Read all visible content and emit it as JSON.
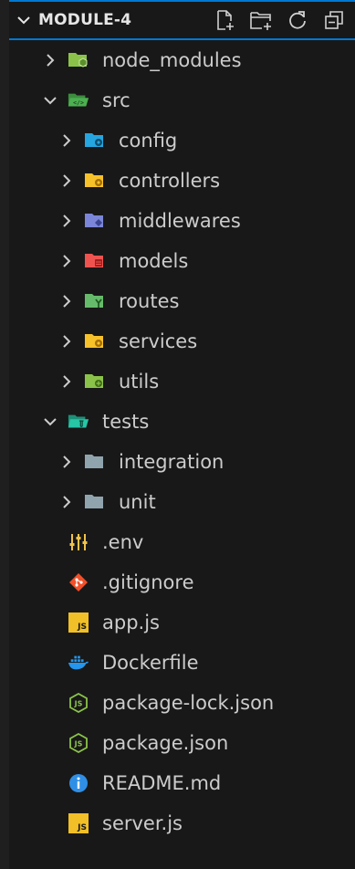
{
  "explorer": {
    "title": "MODULE-4",
    "actions": [
      {
        "name": "new-file-icon"
      },
      {
        "name": "new-folder-icon"
      },
      {
        "name": "refresh-icon"
      },
      {
        "name": "collapse-all-icon"
      }
    ]
  },
  "tree": [
    {
      "label": "node_modules",
      "kind": "folder",
      "expanded": false,
      "depth": 1,
      "icon": "folder-node-icon",
      "color": "#8bc34a"
    },
    {
      "label": "src",
      "kind": "folder",
      "expanded": true,
      "depth": 1,
      "icon": "folder-src-icon",
      "color": "#4caf50"
    },
    {
      "label": "config",
      "kind": "folder",
      "expanded": false,
      "depth": 2,
      "icon": "folder-config-icon",
      "color": "#26a6e0"
    },
    {
      "label": "controllers",
      "kind": "folder",
      "expanded": false,
      "depth": 2,
      "icon": "folder-controllers-icon",
      "color": "#f7c12a"
    },
    {
      "label": "middlewares",
      "kind": "folder",
      "expanded": false,
      "depth": 2,
      "icon": "folder-middlewares-icon",
      "color": "#7b86d8"
    },
    {
      "label": "models",
      "kind": "folder",
      "expanded": false,
      "depth": 2,
      "icon": "folder-models-icon",
      "color": "#ef5350"
    },
    {
      "label": "routes",
      "kind": "folder",
      "expanded": false,
      "depth": 2,
      "icon": "folder-routes-icon",
      "color": "#66bb6a"
    },
    {
      "label": "services",
      "kind": "folder",
      "expanded": false,
      "depth": 2,
      "icon": "folder-services-icon",
      "color": "#f7c12a"
    },
    {
      "label": "utils",
      "kind": "folder",
      "expanded": false,
      "depth": 2,
      "icon": "folder-utils-icon",
      "color": "#8bc34a"
    },
    {
      "label": "tests",
      "kind": "folder",
      "expanded": true,
      "depth": 1,
      "icon": "folder-tests-icon",
      "color": "#26c6a6"
    },
    {
      "label": "integration",
      "kind": "folder",
      "expanded": false,
      "depth": 2,
      "icon": "folder-icon",
      "color": "#90a4ae"
    },
    {
      "label": "unit",
      "kind": "folder",
      "expanded": false,
      "depth": 2,
      "icon": "folder-icon",
      "color": "#90a4ae"
    },
    {
      "label": ".env",
      "kind": "file",
      "depth": 1,
      "icon": "env-settings-icon",
      "color": "#f0c24a"
    },
    {
      "label": ".gitignore",
      "kind": "file",
      "depth": 1,
      "icon": "git-icon",
      "color": "#f0502a"
    },
    {
      "label": "app.js",
      "kind": "file",
      "depth": 1,
      "icon": "javascript-icon",
      "color": "#f1bf27"
    },
    {
      "label": "Dockerfile",
      "kind": "file",
      "depth": 1,
      "icon": "docker-icon",
      "color": "#2496ed"
    },
    {
      "label": "package-lock.json",
      "kind": "file",
      "depth": 1,
      "icon": "nodejs-icon",
      "color": "#8bc34a"
    },
    {
      "label": "package.json",
      "kind": "file",
      "depth": 1,
      "icon": "nodejs-icon",
      "color": "#8bc34a"
    },
    {
      "label": "README.md",
      "kind": "file",
      "depth": 1,
      "icon": "info-icon",
      "color": "#2f8fe6"
    },
    {
      "label": "server.js",
      "kind": "file",
      "depth": 1,
      "icon": "javascript-icon",
      "color": "#f1bf27"
    }
  ]
}
